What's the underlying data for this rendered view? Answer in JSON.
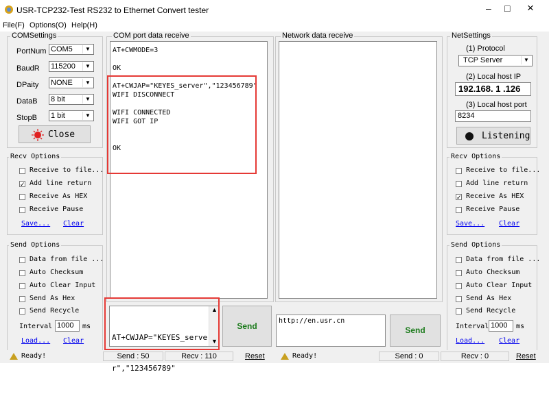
{
  "window": {
    "title": "USR-TCP232-Test  RS232 to Ethernet Convert tester",
    "minimize": "–",
    "maximize": "□",
    "close": "×"
  },
  "menu": {
    "file": "File(F)",
    "options": "Options(O)",
    "help": "Help(H)"
  },
  "com": {
    "group_label": "COMSettings",
    "port_label": "PortNum",
    "port_value": "COM5",
    "baud_label": "BaudR",
    "baud_value": "115200",
    "parity_label": "DPaity",
    "parity_value": "NONE",
    "data_label": "DataB",
    "data_value": "8 bit",
    "stop_label": "StopB",
    "stop_value": "1 bit",
    "close_label": "Close"
  },
  "recv_left": {
    "group_label": "Recv Options",
    "receive_to_file": "Receive to file...",
    "add_line_return": "Add line return",
    "receive_as_hex": "Receive As HEX",
    "receive_pause": "Receive Pause",
    "save": "Save...",
    "clear": "Clear"
  },
  "send_left": {
    "group_label": "Send Options",
    "data_from_file": "Data from file ...",
    "auto_checksum": "Auto Checksum",
    "auto_clear": "Auto Clear Input",
    "send_as_hex": "Send As Hex",
    "send_recycle": "Send Recycle",
    "interval_label": "Interval",
    "interval_value": "1000",
    "interval_unit": "ms",
    "load": "Load...",
    "clear": "Clear"
  },
  "com_receive": {
    "group_label": "COM port data receive",
    "lines": [
      "AT+CWMODE=3",
      "",
      "OK",
      "",
      "AT+CWJAP=\"KEYES_server\",\"123456789\"",
      "WIFI DISCONNECT",
      "",
      "WIFI CONNECTED",
      "WIFI GOT IP",
      "",
      "",
      "OK"
    ]
  },
  "com_send": {
    "line1": "AT+CWJAP=\"KEYES_serve",
    "line2": "r\",\"123456789\"",
    "button": "Send"
  },
  "net_receive": {
    "group_label": "Network data receive"
  },
  "net_send": {
    "value": "http://en.usr.cn",
    "button": "Send"
  },
  "net": {
    "group_label": "NetSettings",
    "protocol_label": "(1) Protocol",
    "protocol_value": "TCP Server",
    "host_label": "(2) Local host IP",
    "host_value": "192.168. 1 .126",
    "port_label": "(3) Local host port",
    "port_value": "8234",
    "listen_label": "Listening"
  },
  "recv_right": {
    "group_label": "Recv Options",
    "receive_to_file": "Receive to file...",
    "add_line_return": "Add line return",
    "receive_as_hex": "Receive As HEX",
    "receive_pause": "Receive Pause",
    "save": "Save...",
    "clear": "Clear"
  },
  "send_right": {
    "group_label": "Send Options",
    "data_from_file": "Data from file ...",
    "auto_checksum": "Auto Checksum",
    "auto_clear": "Auto Clear Input",
    "send_as_hex": "Send As Hex",
    "send_recycle": "Send Recycle",
    "interval_label": "Interval",
    "interval_value": "1000",
    "interval_unit": "ms",
    "load": "Load...",
    "clear": "Clear"
  },
  "status_left": {
    "ready": "Ready!",
    "send": "Send : 50",
    "recv": "Recv : 110",
    "reset": "Reset"
  },
  "status_right": {
    "ready": "Ready!",
    "send": "Send : 0",
    "recv": "Recv : 0",
    "reset": "Reset"
  },
  "colors": {
    "highlight": "#e53935",
    "link": "#0000ee"
  }
}
